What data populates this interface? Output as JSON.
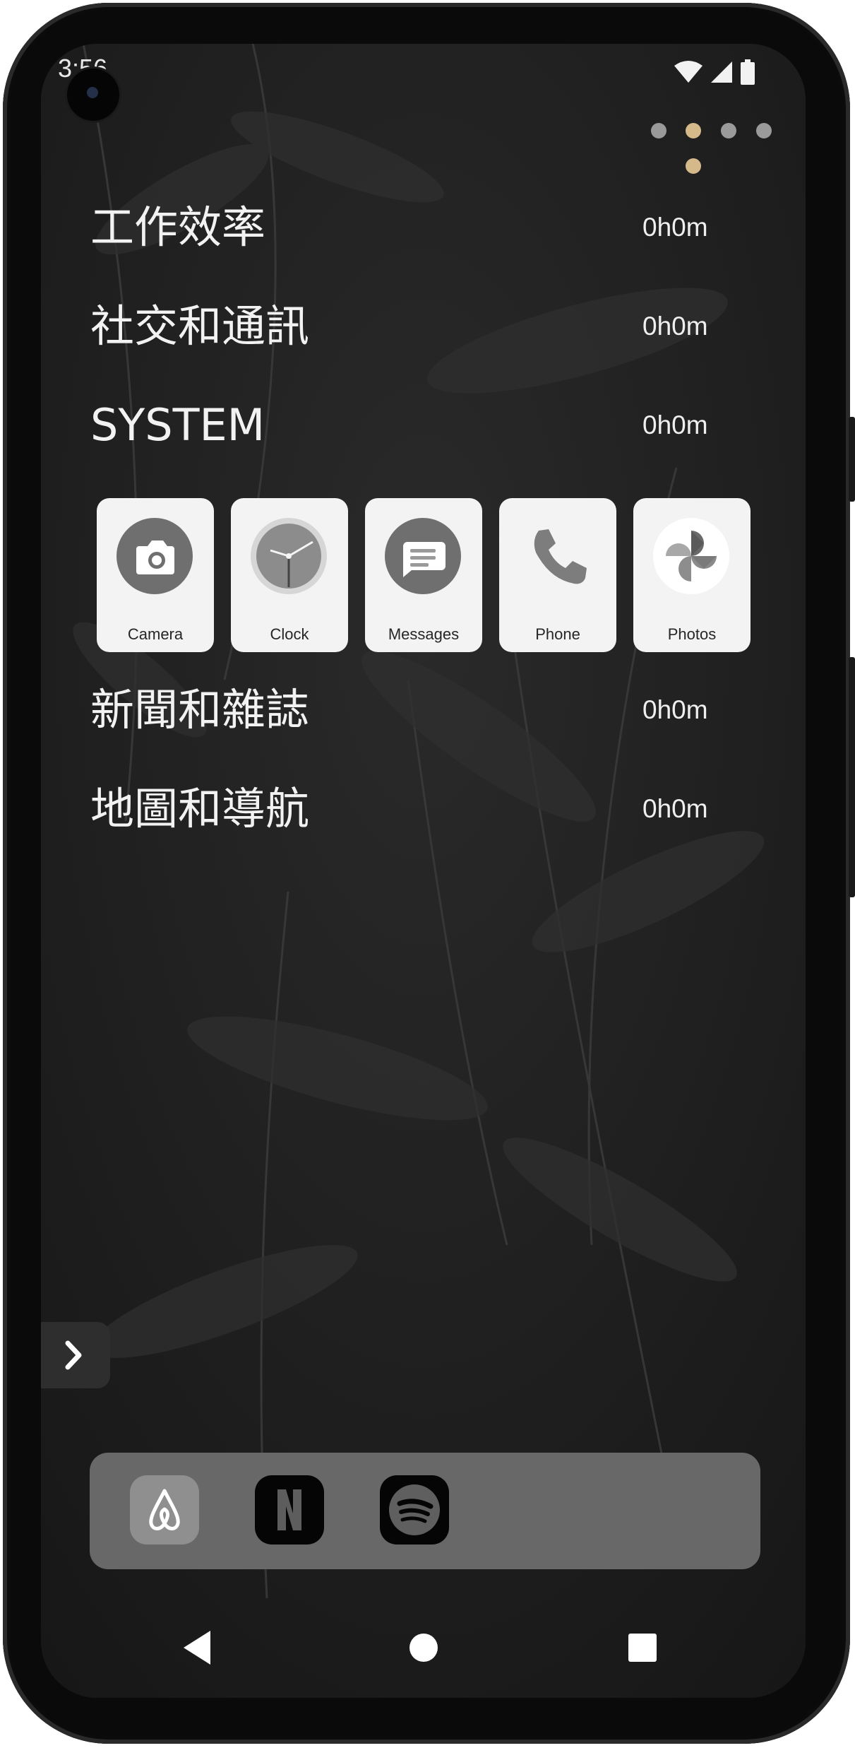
{
  "status_bar": {
    "time": "3:56"
  },
  "page_indicator": {
    "dots": 5,
    "active_index": 1,
    "active_color": "#d6b98a",
    "inactive_color": "#9a9a9a"
  },
  "categories": [
    {
      "label": "工作效率",
      "time": "0h0m"
    },
    {
      "label": "社交和通訊",
      "time": "0h0m"
    },
    {
      "label": "SYSTEM",
      "time": "0h0m"
    },
    {
      "label": "新聞和雜誌",
      "time": "0h0m"
    },
    {
      "label": "地圖和導航",
      "time": "0h0m"
    }
  ],
  "system_apps": [
    {
      "label": "Camera",
      "icon": "camera-icon"
    },
    {
      "label": "Clock",
      "icon": "clock-icon"
    },
    {
      "label": "Messages",
      "icon": "messages-icon"
    },
    {
      "label": "Phone",
      "icon": "phone-icon"
    },
    {
      "label": "Photos",
      "icon": "photos-icon"
    }
  ],
  "dock": {
    "apps": [
      {
        "icon": "airbnb-icon"
      },
      {
        "icon": "netflix-icon"
      },
      {
        "icon": "spotify-icon"
      }
    ]
  },
  "nav_bar": {
    "items": [
      "back-icon",
      "home-icon",
      "recents-icon"
    ]
  }
}
